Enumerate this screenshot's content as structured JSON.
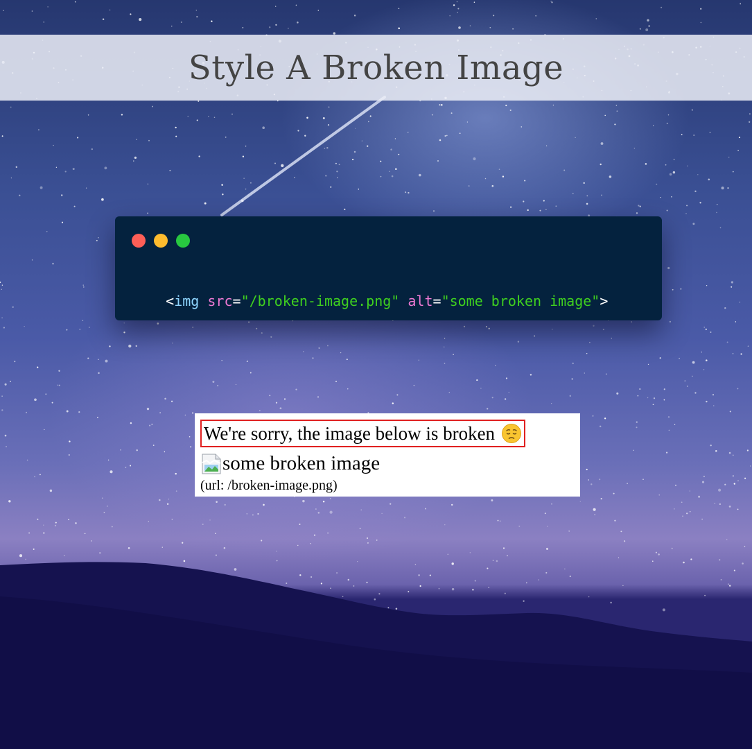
{
  "header": {
    "title": "Style A Broken Image"
  },
  "code_window": {
    "code": [
      {
        "text": "<",
        "kind": "punct"
      },
      {
        "text": "img",
        "kind": "tag"
      },
      {
        "text": " ",
        "kind": "punct"
      },
      {
        "text": "src",
        "kind": "attr"
      },
      {
        "text": "=",
        "kind": "punct"
      },
      {
        "text": "\"/broken-image.png\"",
        "kind": "str"
      },
      {
        "text": " ",
        "kind": "punct"
      },
      {
        "text": "alt",
        "kind": "attr"
      },
      {
        "text": "=",
        "kind": "punct"
      },
      {
        "text": "\"some broken image\"",
        "kind": "str"
      },
      {
        "text": ">",
        "kind": "punct"
      }
    ],
    "window_controls": [
      "close-dot",
      "minimize-dot",
      "maximize-dot"
    ]
  },
  "result_panel": {
    "notice_text": "We're sorry, the image below is broken",
    "notice_emoji": "pensive-face-icon",
    "alt_text": "some broken image",
    "url_text": "(url: /broken-image.png)"
  },
  "colors": {
    "notice_border": "#e02020",
    "code_background": "#04223e",
    "code_tag": "#8fd6ff",
    "code_attr": "#f07ad5",
    "code_string": "#3fd01f",
    "dot_red": "#fe5f57",
    "dot_yellow": "#febc2e",
    "dot_green": "#28c840"
  }
}
